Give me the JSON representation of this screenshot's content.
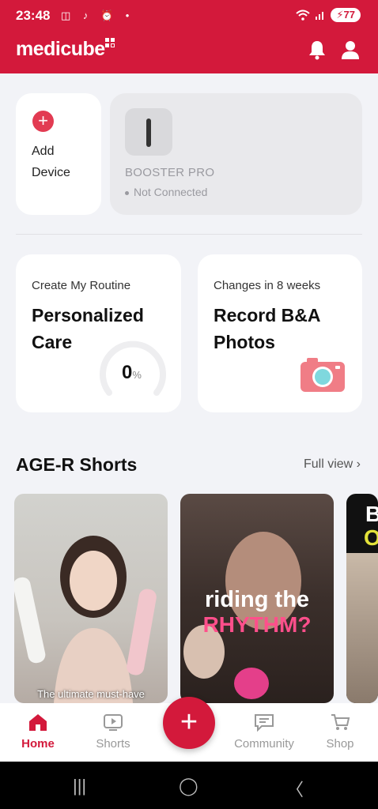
{
  "status_bar": {
    "time": "23:48",
    "battery": "77",
    "left_icons": "◫ ♪ ⏰ •"
  },
  "header": {
    "logo": "medicube",
    "brand_color": "#d3193b",
    "icons": [
      "bell-icon",
      "user-icon"
    ]
  },
  "devices": {
    "add_label": "Add Device",
    "device_name": "BOOSTER PRO",
    "device_status": "Not Connected"
  },
  "routine_card": {
    "subtitle": "Create My Routine",
    "title": "Personalized Care",
    "progress_value": "0",
    "progress_unit": "%",
    "progress_fraction": 0
  },
  "record_card": {
    "subtitle": "Changes in 8 weeks",
    "title": "Record B&A Photos"
  },
  "shorts": {
    "title": "AGE-R Shorts",
    "full_view": "Full view",
    "items": [
      {
        "caption": "The ultimate must-have"
      },
      {
        "caption_line1": "riding the",
        "caption_line2": "RHYTHM?"
      },
      {
        "caption_line1": "B",
        "caption_line2": "O"
      }
    ]
  },
  "bottom_nav": {
    "items": [
      {
        "label": "Home",
        "icon": "home-icon",
        "active": true
      },
      {
        "label": "Shorts",
        "icon": "play-icon",
        "active": false
      },
      {
        "label": "Community",
        "icon": "chat-icon",
        "active": false
      },
      {
        "label": "Shop",
        "icon": "cart-icon",
        "active": false
      }
    ],
    "fab_label": "+"
  },
  "system_nav": {
    "recent": "|||",
    "home": "◯",
    "back": "〈"
  }
}
